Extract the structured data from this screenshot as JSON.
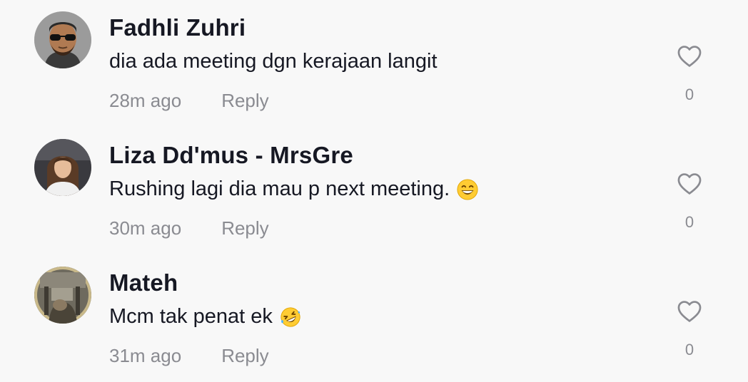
{
  "comments": [
    {
      "username": "Fadhli Zuhri",
      "text": "dia ada meeting dgn kerajaan langit",
      "emoji": "",
      "time": "28m ago",
      "reply_label": "Reply",
      "like_count": "0",
      "avatar": "avatar-man-sunglasses-beard"
    },
    {
      "username": "Liza Dd'mus - MrsGre",
      "text": "Rushing lagi dia mau p next meeting.",
      "emoji": "grinning-face-emoji",
      "time": "30m ago",
      "reply_label": "Reply",
      "like_count": "0",
      "avatar": "avatar-woman-long-hair"
    },
    {
      "username": "Mateh",
      "text": "Mcm tak penat ek",
      "emoji": "rolling-on-floor-laughing-emoji",
      "time": "31m ago",
      "reply_label": "Reply",
      "like_count": "0",
      "avatar": "avatar-dim-room-photo"
    }
  ],
  "icons": {
    "like": "heart-outline-icon"
  },
  "colors": {
    "background": "#f8f8f8",
    "primary_text": "#161823",
    "secondary_text": "#8a8b91"
  }
}
